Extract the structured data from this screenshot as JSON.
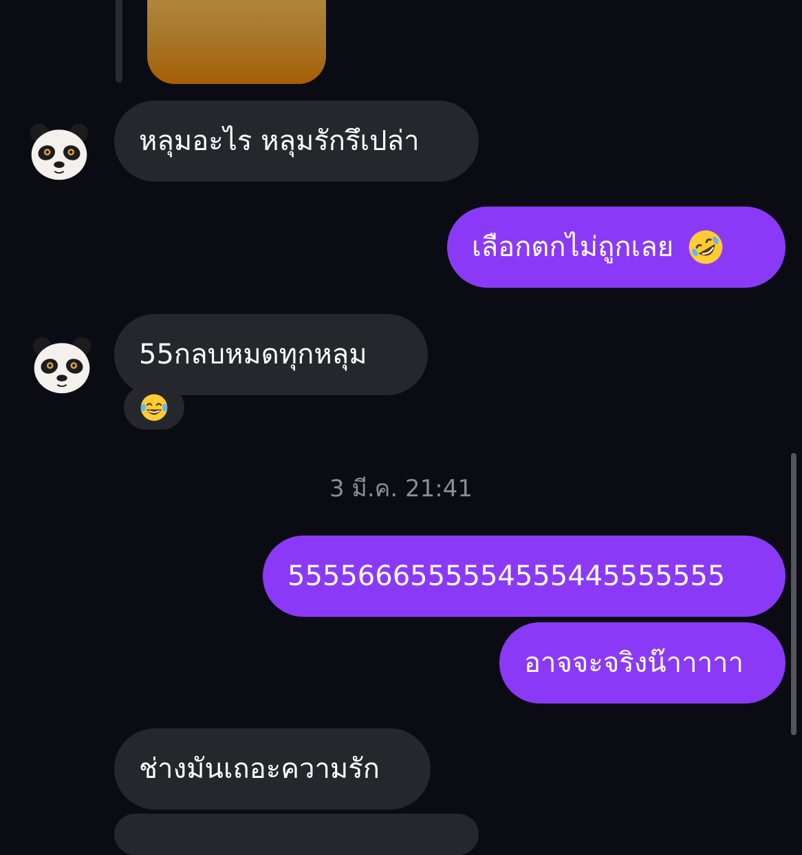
{
  "messages": [
    {
      "text": "หลุมอะไร หลุมรักรึเปล่า",
      "side": "incoming"
    },
    {
      "text": "เลือกตกไม่ถูกเลย",
      "side": "outgoing",
      "emoji": "rolling-on-floor-laughing"
    },
    {
      "text": "55กลบหมดทุกหลุม",
      "side": "incoming",
      "reaction": "face-with-tears-of-joy"
    },
    {
      "text": "5555666555554555445555555",
      "side": "outgoing"
    },
    {
      "text": "อาจจะจริงน๊าาาาา",
      "side": "outgoing"
    },
    {
      "text": "ช่างมันเถอะความรัก",
      "side": "incoming"
    }
  ],
  "timestamp": "3 มี.ค. 21:41",
  "colors": {
    "background": "#0b0b13",
    "incoming_bubble": "#26272c",
    "outgoing_bubble": "#8a3af7",
    "timestamp_text": "#8b8c94"
  },
  "icons": {
    "avatar": "panda-avatar",
    "emoji_sent": "rolling-on-floor-laughing-emoji",
    "reaction": "face-with-tears-of-joy-emoji"
  }
}
